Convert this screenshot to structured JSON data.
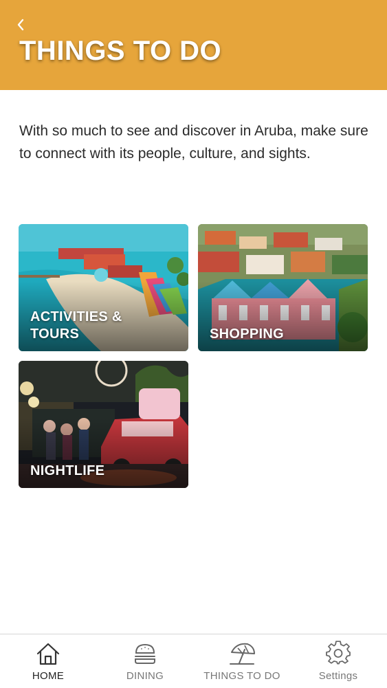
{
  "header": {
    "title": "THINGS TO DO",
    "back_icon": "chevron-left-icon",
    "color": "#e6a53b"
  },
  "intro": {
    "text": "With so much to see and discover in Aruba, make sure to connect with its people, culture, and sights."
  },
  "categories": [
    {
      "label": "ACTIVITIES & TOURS"
    },
    {
      "label": "SHOPPING"
    },
    {
      "label": "NIGHTLIFE"
    }
  ],
  "tabbar": {
    "items": [
      {
        "label": "HOME",
        "icon": "home-icon",
        "active": true
      },
      {
        "label": "DINING",
        "icon": "burger-icon",
        "active": false
      },
      {
        "label": "THINGS TO DO",
        "icon": "beach-umbrella-icon",
        "active": false
      },
      {
        "label": "Settings",
        "icon": "gear-icon",
        "active": false
      }
    ]
  }
}
